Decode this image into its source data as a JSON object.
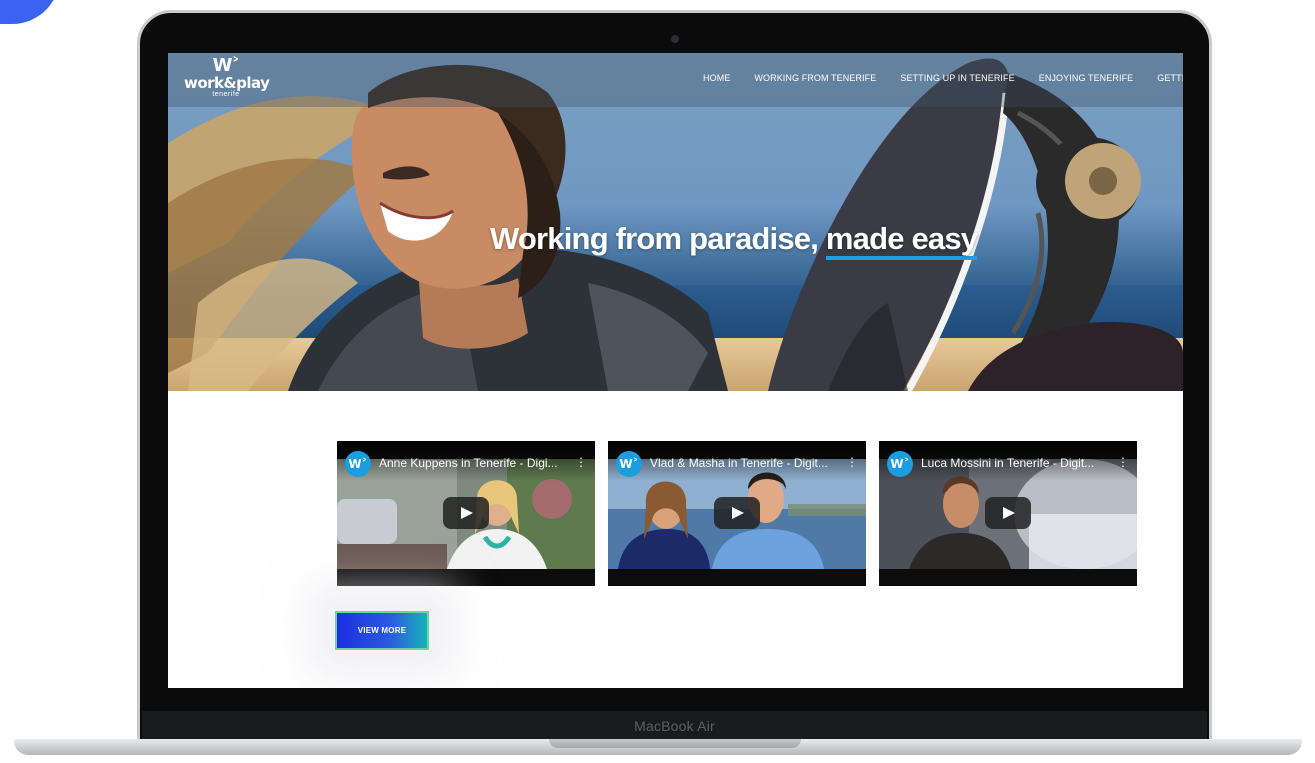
{
  "device": {
    "label": "MacBook Air"
  },
  "site": {
    "logo": {
      "mark": "W˃",
      "name": "work&play",
      "sub": "tenerife"
    },
    "nav": [
      {
        "label": "HOME"
      },
      {
        "label": "WORKING FROM TENERIFE"
      },
      {
        "label": "SETTING UP IN TENERIFE"
      },
      {
        "label": "ENJOYING TENERIFE"
      },
      {
        "label": "GETTING TO T"
      }
    ],
    "hero": {
      "title_start": "Working from paradise, ",
      "title_highlight": "made easy"
    },
    "videos": [
      {
        "badge": "W˃",
        "title": "Anne Kuppens in Tenerife - Digi...",
        "menu": "⋮"
      },
      {
        "badge": "W˃",
        "title": "Vlad & Masha in Tenerife - Digit...",
        "menu": "⋮"
      },
      {
        "badge": "W˃",
        "title": "Luca Mossini in Tenerife - Digit...",
        "menu": "⋮"
      }
    ],
    "view_more_label": "VIEW MORE"
  },
  "colors": {
    "accent_blue": "#1fa0e6",
    "button_gradient_start": "#1b2fe0",
    "button_gradient_end": "#17b2b8",
    "badge": "#1c9ddf"
  }
}
